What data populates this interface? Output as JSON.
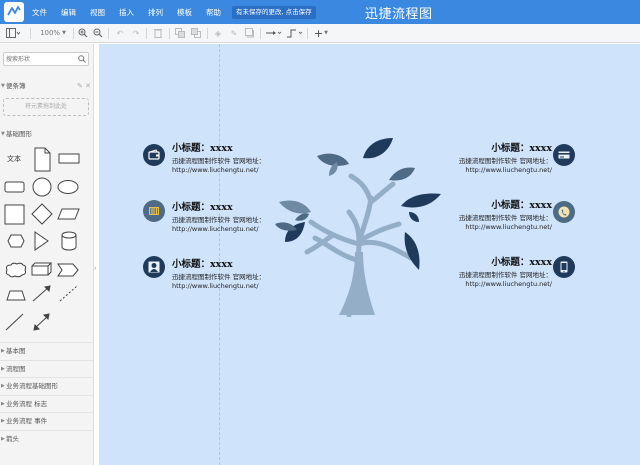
{
  "header": {
    "menu": [
      "文件",
      "编辑",
      "视图",
      "插入",
      "排列",
      "模板",
      "帮助"
    ],
    "save_notice": "有未保存的更改, 点击保存",
    "app_title": "迅捷流程图"
  },
  "toolbar": {
    "zoom": "100%"
  },
  "sidebar": {
    "search_placeholder": "搜索形状",
    "sticky_section": "便条簿",
    "dropzone": "将元素拖到此处",
    "basic_section": "基础图形",
    "text_shape": "文本",
    "sections": [
      "基本图",
      "流程图",
      "业务流程基础图形",
      "业务流程 标志",
      "业务流程 事件",
      "箭头"
    ]
  },
  "canvas": {
    "blocks_left": [
      {
        "title": "小标题：xxxx",
        "desc": "迅捷流程图制作软件 官网地址：",
        "url": "http://www.liuchengtu.net/",
        "icon": "wallet-icon"
      },
      {
        "title": "小标题：xxxx",
        "desc": "迅捷流程图制作软件 官网地址：",
        "url": "http://www.liuchengtu.net/",
        "icon": "barcode-icon"
      },
      {
        "title": "小标题：xxxx",
        "desc": "迅捷流程图制作软件 官网地址：",
        "url": "http://www.liuchengtu.net/",
        "icon": "user-icon"
      }
    ],
    "blocks_right": [
      {
        "title": "小标题：xxxx",
        "desc": "迅捷流程图制作软件 官网地址：",
        "url": "http://www.liuchengtu.net/",
        "icon": "card-icon"
      },
      {
        "title": "小标题：xxxx",
        "desc": "迅捷流程图制作软件 官网地址：",
        "url": "http://www.liuchengtu.net/",
        "icon": "phone-icon"
      },
      {
        "title": "小标题：xxxx",
        "desc": "迅捷流程图制作软件 官网地址：",
        "url": "http://www.liuchengtu.net/",
        "icon": "mobile-icon"
      }
    ]
  },
  "colors": {
    "header": "#3a88e0",
    "canvas_page": "#cfe3fb",
    "dark_navy": "#1f3a5a",
    "slate": "#4f6a85",
    "leaf_gray": "#6f8aa3",
    "trunk": "#93aec6"
  }
}
